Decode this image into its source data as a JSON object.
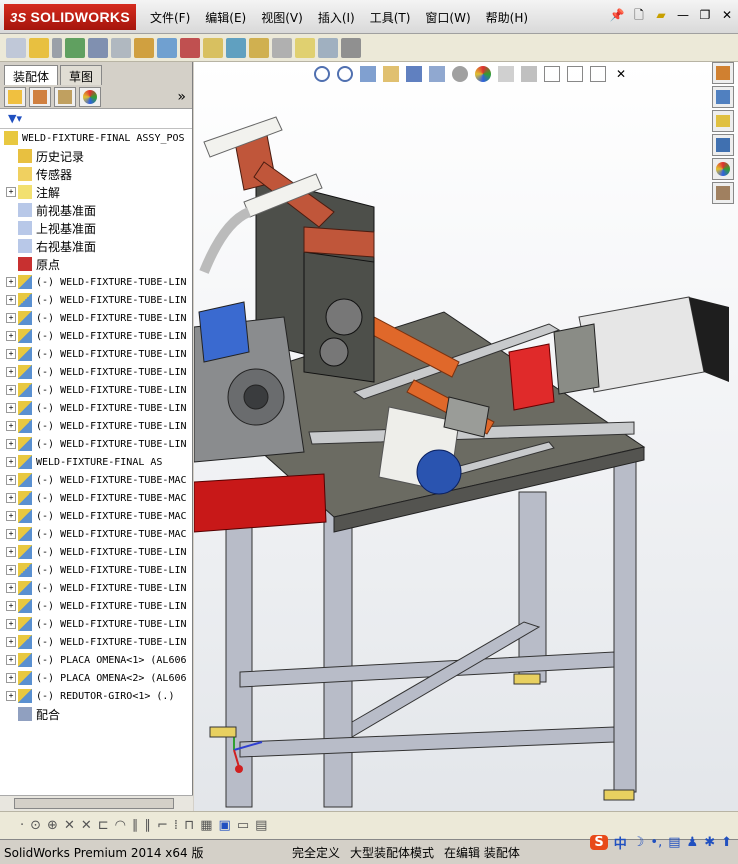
{
  "app": {
    "brand_prefix": "3S",
    "brand": "SOLIDWORKS"
  },
  "menu": [
    "文件(F)",
    "编辑(E)",
    "视图(V)",
    "插入(I)",
    "工具(T)",
    "窗口(W)",
    "帮助(H)"
  ],
  "tabs": {
    "assembly": "装配体",
    "sketch": "草图"
  },
  "tree": {
    "root": "WELD-FIXTURE-FINAL ASSY_POS",
    "fixed_items": [
      {
        "label": "历史记录",
        "icon": "history-icon"
      },
      {
        "label": "传感器",
        "icon": "sensor-icon"
      },
      {
        "label": "注解",
        "icon": "annotation-icon"
      },
      {
        "label": "前视基准面",
        "icon": "plane-icon"
      },
      {
        "label": "上视基准面",
        "icon": "plane-icon"
      },
      {
        "label": "右视基准面",
        "icon": "plane-icon"
      },
      {
        "label": "原点",
        "icon": "origin-icon"
      }
    ],
    "components": [
      "(-) WELD-FIXTURE-TUBE-LIN",
      "(-) WELD-FIXTURE-TUBE-LIN",
      "(-) WELD-FIXTURE-TUBE-LIN",
      "(-) WELD-FIXTURE-TUBE-LIN",
      "(-) WELD-FIXTURE-TUBE-LIN",
      "(-) WELD-FIXTURE-TUBE-LIN",
      "(-) WELD-FIXTURE-TUBE-LIN",
      "(-) WELD-FIXTURE-TUBE-LIN",
      "(-) WELD-FIXTURE-TUBE-LIN",
      "(-) WELD-FIXTURE-TUBE-LIN",
      "WELD-FIXTURE-FINAL AS",
      "(-) WELD-FIXTURE-TUBE-MAC",
      "(-) WELD-FIXTURE-TUBE-MAC",
      "(-) WELD-FIXTURE-TUBE-MAC",
      "(-) WELD-FIXTURE-TUBE-MAC",
      "(-) WELD-FIXTURE-TUBE-LIN",
      "(-) WELD-FIXTURE-TUBE-LIN",
      "(-) WELD-FIXTURE-TUBE-LIN",
      "(-) WELD-FIXTURE-TUBE-LIN",
      "(-) WELD-FIXTURE-TUBE-LIN",
      "(-) WELD-FIXTURE-TUBE-LIN",
      "(-) PLACA OMENA<1> (AL606",
      "(-) PLACA OMENA<2> (AL606",
      "(-) REDUTOR-GIRO<1> (.)"
    ],
    "mates": "配合"
  },
  "status": {
    "product": "SolidWorks Premium 2014 x64 版",
    "definition": "完全定义",
    "mode": "大型装配体模式",
    "editing": "在编辑 装配体"
  },
  "ime": {
    "lang": "中"
  }
}
